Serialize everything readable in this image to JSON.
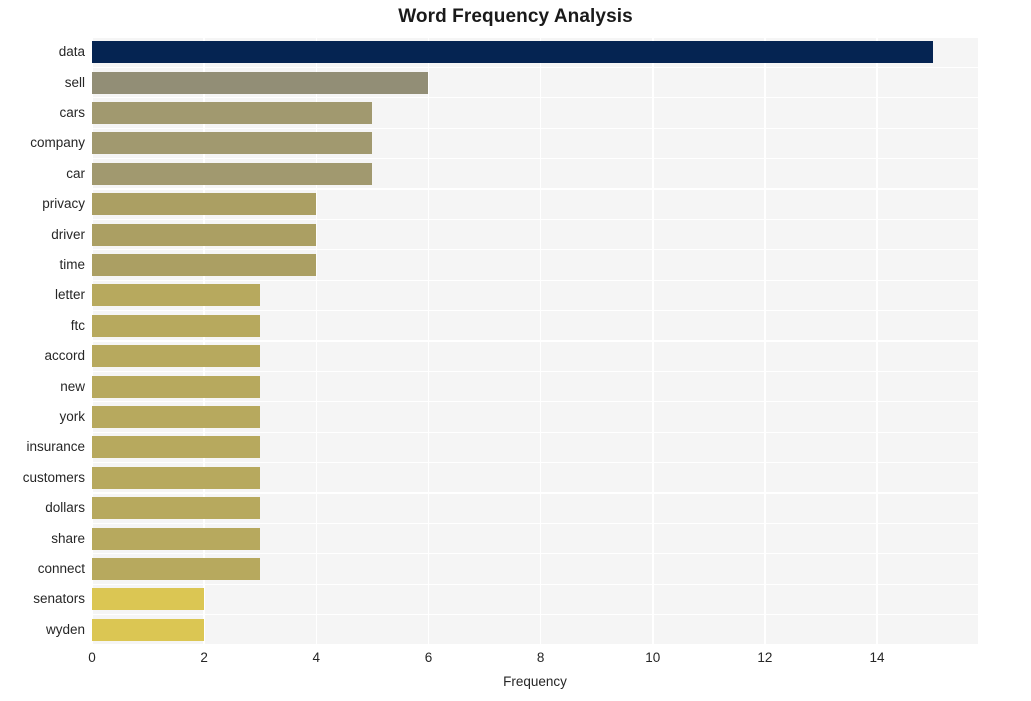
{
  "chart_data": {
    "type": "bar",
    "orientation": "horizontal",
    "title": "Word Frequency Analysis",
    "xlabel": "Frequency",
    "ylabel": "",
    "categories": [
      "data",
      "sell",
      "cars",
      "company",
      "car",
      "privacy",
      "driver",
      "time",
      "letter",
      "ftc",
      "accord",
      "new",
      "york",
      "insurance",
      "customers",
      "dollars",
      "share",
      "connect",
      "senators",
      "wyden"
    ],
    "values": [
      15,
      6,
      5,
      5,
      5,
      4,
      4,
      4,
      3,
      3,
      3,
      3,
      3,
      3,
      3,
      3,
      3,
      3,
      2,
      2
    ],
    "bar_colors": [
      "#052452",
      "#928e76",
      "#a1996f",
      "#a1996f",
      "#a1996f",
      "#ab9f63",
      "#ab9f63",
      "#ab9f63",
      "#b7a95e",
      "#b7a95e",
      "#b7a95e",
      "#b7a95e",
      "#b7a95e",
      "#b7a95e",
      "#b7a95e",
      "#b7a95e",
      "#b7a95e",
      "#b7a95e",
      "#dbc653",
      "#dbc653"
    ],
    "xlim": [
      0,
      15.8
    ],
    "xticks": [
      0,
      2,
      4,
      6,
      8,
      10,
      12,
      14
    ],
    "xtick_labels": [
      "0",
      "2",
      "4",
      "6",
      "8",
      "10",
      "12",
      "14"
    ],
    "grid": true,
    "grid_color": "#ffffff",
    "plot_background": "#f5f5f5",
    "figure_background": "#ffffff",
    "legend": null
  }
}
